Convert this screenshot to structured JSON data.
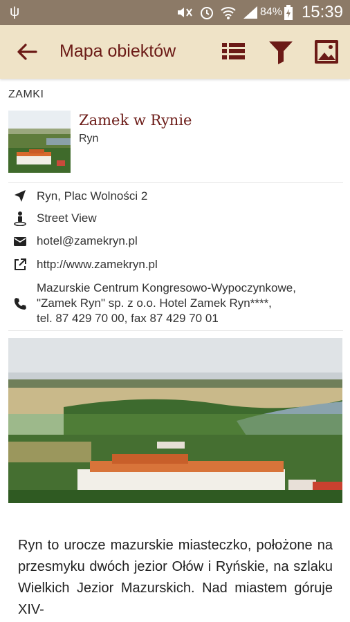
{
  "status_bar": {
    "usb_icon": "usb-icon",
    "battery_percent": "84%",
    "time": "15:39"
  },
  "app_bar": {
    "title": "Mapa obiektów",
    "actions": [
      "list-icon",
      "filter-icon",
      "image-icon"
    ],
    "accent_color": "#6b1a16",
    "background_color": "#efe3c7"
  },
  "section": {
    "label": "ZAMKI"
  },
  "object": {
    "name": "Zamek w Rynie",
    "city": "Ryn"
  },
  "details": {
    "address": "Ryn, Plac Wolności 2",
    "street_view": "Street View",
    "email": "hotel@zamekryn.pl",
    "website": "http://www.zamekryn.pl",
    "contact_lines": [
      "Mazurskie Centrum Kongresowo-Wypoczynkowe,",
      "\"Zamek Ryn\" sp. z o.o. Hotel Zamek Ryn****,",
      "tel. 87 429 70 00, fax 87 429 70 01"
    ]
  },
  "description": {
    "text": "Ryn to urocze mazurskie miasteczko, położone na przesmyku dwóch jezior Ołów i Ryńskie, na szlaku Wielkich Jezior Mazurskich. Nad miastem góruje XIV-"
  }
}
